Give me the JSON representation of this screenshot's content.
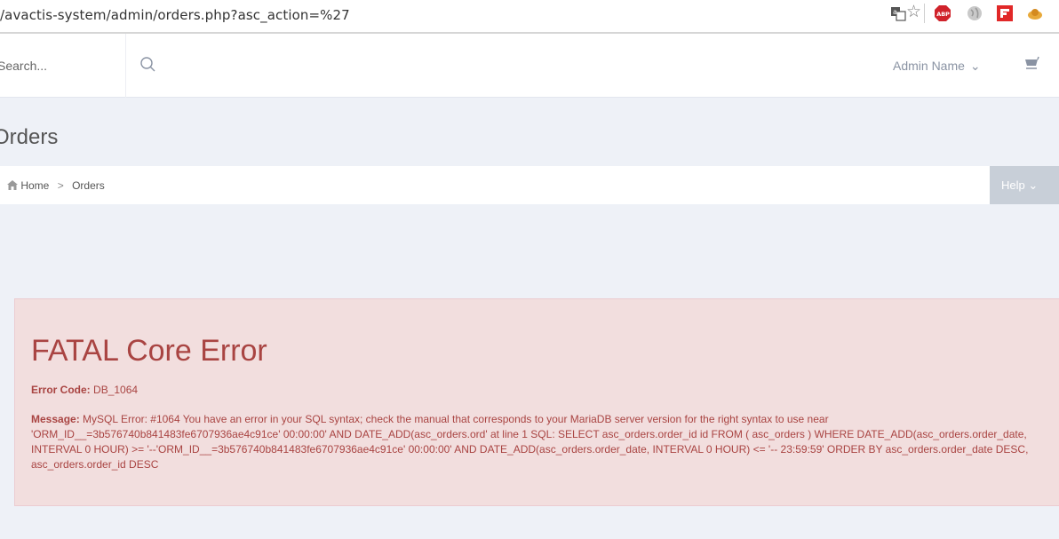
{
  "browser": {
    "url": "/avactis-system/admin/orders.php?asc_action=%27",
    "extension_icons": [
      "translate-icon",
      "star-icon",
      "adblock-plus-icon",
      "globe-icon",
      "flipboard-icon",
      "extension-icon"
    ]
  },
  "header": {
    "search_placeholder": "Search...",
    "search_icon": "search-icon",
    "user_menu_label": "Admin Name",
    "user_menu_chevron": "⌄",
    "cart_icon": "cart-icon"
  },
  "page": {
    "title": "Orders"
  },
  "breadcrumb": {
    "home_label": "Home",
    "separator": ">",
    "current_label": "Orders"
  },
  "help": {
    "label": "Help",
    "chevron": "⌄"
  },
  "error": {
    "title": "FATAL Core Error",
    "code_label": "Error Code:",
    "code_value": "DB_1064",
    "message_label": "Message:",
    "message_text": "MySQL Error: #1064 You have an error in your SQL syntax; check the manual that corresponds to your MariaDB server version for the right syntax to use near 'ORM_ID__=3b576740b841483fe6707936ae4c91ce' 00:00:00' AND DATE_ADD(asc_orders.ord' at line 1 SQL: SELECT asc_orders.order_id id FROM ( asc_orders ) WHERE DATE_ADD(asc_orders.order_date, INTERVAL 0 HOUR) >= '--'ORM_ID__=3b576740b841483fe6707936ae4c91ce' 00:00:00' AND DATE_ADD(asc_orders.order_date, INTERVAL 0 HOUR) <= '-- 23:59:59' ORDER BY asc_orders.order_date DESC, asc_orders.order_id DESC"
  },
  "colors": {
    "page_bg": "#eef1f7",
    "error_bg": "#f2dede",
    "error_text": "#a94442",
    "help_bg": "#c8cfd8",
    "muted_text": "#8a93a3"
  }
}
